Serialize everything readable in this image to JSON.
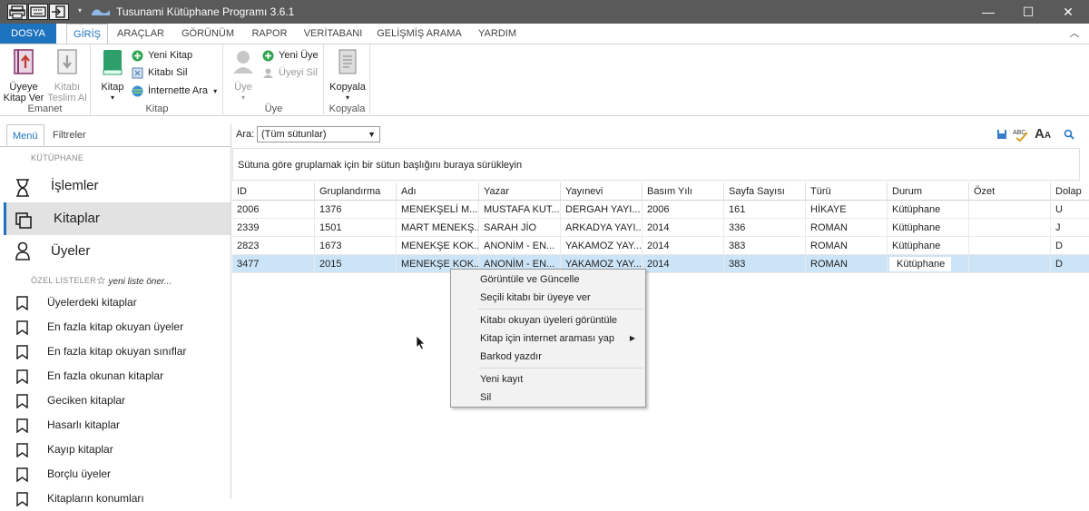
{
  "window": {
    "title": "Tusunami Kütüphane Programı 3.6.1",
    "minimize": "—",
    "maximize": "☐",
    "close": "✕"
  },
  "ribbon_tabs": [
    "DOSYA",
    "GİRİŞ",
    "ARAÇLAR",
    "GÖRÜNÜM",
    "RAPOR",
    "VERİTABANI",
    "GELİŞMİŞ ARAMA",
    "YARDIM"
  ],
  "ribbon": {
    "emanet": {
      "label": "Emanet",
      "give": "Üyeye\nKitap Ver",
      "return": "Kitabı\nTeslim Al"
    },
    "kitap": {
      "label": "Kitap",
      "main": "Kitap",
      "new": "Yeni Kitap",
      "delete": "Kitabı Sil",
      "search": "İnternette Ara"
    },
    "uye": {
      "label": "Üye",
      "main": "Üye",
      "new": "Yeni Üye",
      "delete": "Üyeyi Sil"
    },
    "kopyala": {
      "label": "Kopyala",
      "main": "Kopyala"
    },
    "collapse": "︿"
  },
  "left_panel": {
    "tabs": [
      "Menü",
      "Filtreler"
    ],
    "section_library": "KÜTÜPHANE",
    "nav": [
      "İşlemler",
      "Kitaplar",
      "Üyeler"
    ],
    "section_lists": "ÖZEL LİSTELER",
    "suggest": "yeni liste öner...",
    "lists": [
      "Üyelerdeki kitaplar",
      "En fazla kitap okuyan üyeler",
      "En fazla kitap okuyan sınıflar",
      "En fazla okunan kitaplar",
      "Geciken kitaplar",
      "Hasarlı kitaplar",
      "Kayıp kitaplar",
      "Borçlu üyeler",
      "Kitapların konumları"
    ]
  },
  "search": {
    "label": "Ara:",
    "value": "(Tüm sütunlar)"
  },
  "group_panel": "Sütuna göre gruplamak için bir sütun başlığını buraya sürükleyin",
  "grid": {
    "columns": [
      "ID",
      "Gruplandırma",
      "Adı",
      "Yazar",
      "Yayınevi",
      "Basım Yılı",
      "Sayfa Sayısı",
      "Türü",
      "Durum",
      "Özet",
      "Dolap"
    ],
    "rows": [
      [
        "2006",
        "1376",
        "MENEKŞELİ M...",
        "MUSTAFA KUT...",
        "DERGAH YAYI...",
        "2006",
        "161",
        "HİKAYE",
        "Kütüphane",
        "",
        "U"
      ],
      [
        "2339",
        "1501",
        "MART MENEKŞ...",
        "SARAH JİO",
        "ARKADYA YAYI...",
        "2014",
        "336",
        "ROMAN",
        "Kütüphane",
        "",
        "J"
      ],
      [
        "2823",
        "1673",
        "MENEKŞE KOK...",
        "ANONİM - EN...",
        "YAKAMOZ YAY...",
        "2014",
        "383",
        "ROMAN",
        "Kütüphane",
        "",
        "D"
      ],
      [
        "3477",
        "2015",
        "MENEKŞE KOK...",
        "ANONİM - EN...",
        "YAKAMOZ YAY...",
        "2014",
        "383",
        "ROMAN",
        "Kütüphane",
        "",
        "D"
      ]
    ]
  },
  "context_menu": {
    "items": [
      "Görüntüle ve Güncelle",
      "Seçili kitabı bir üyeye ver",
      "Kitabı okuyan üyeleri görüntüle",
      "Kitap için internet araması yap",
      "Barkod yazdır",
      "Yeni kayıt",
      "Sil"
    ]
  },
  "colors": {
    "accent": "#1e73be",
    "titlebar": "#5a5a5a",
    "selected_row": "#cce4f7"
  }
}
